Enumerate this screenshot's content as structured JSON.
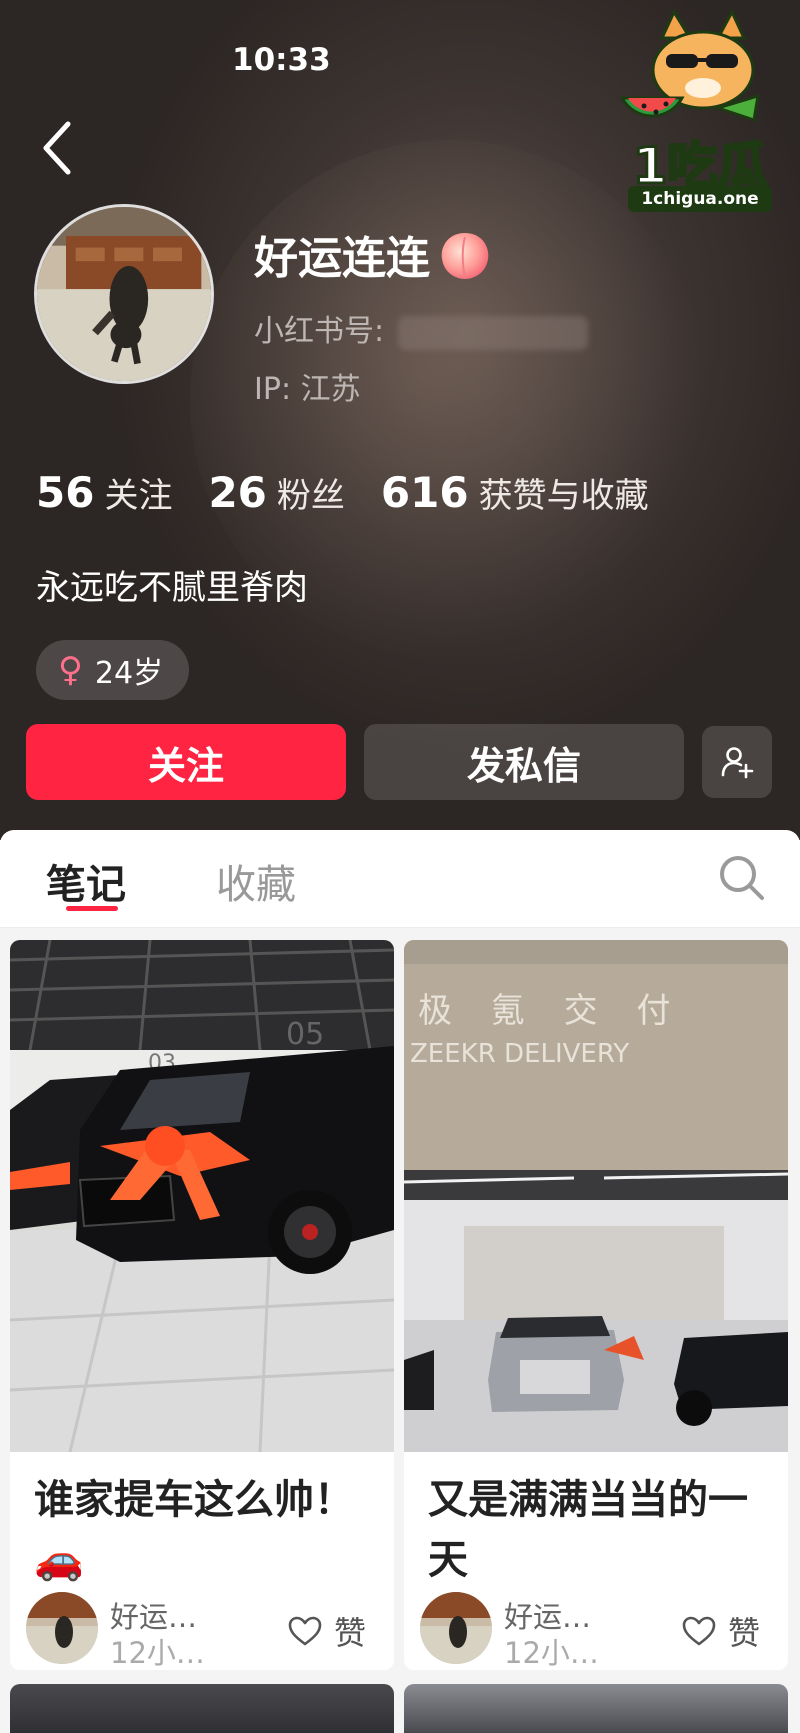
{
  "status_bar": {
    "time": "10:33"
  },
  "profile": {
    "nickname": "好运连连",
    "red_id_label": "小红书号:",
    "ip_location": "IP: 江苏",
    "stats": [
      {
        "value": "56",
        "label": "关注"
      },
      {
        "value": "26",
        "label": "粉丝"
      },
      {
        "value": "616",
        "label": "获赞与收藏"
      }
    ],
    "bio": "永远吃不腻里脊肉",
    "gender_symbol": "♀",
    "age_tag": "24岁"
  },
  "actions": {
    "follow_label": "关注",
    "message_label": "发私信"
  },
  "tabs": [
    {
      "label": "笔记",
      "active": true
    },
    {
      "label": "收藏",
      "active": false
    }
  ],
  "notes": [
    {
      "title": "谁家提车这么帅！🚗",
      "author": "好运…",
      "time": "12小…",
      "like_label": "赞"
    },
    {
      "title": "又是满满当当的一天",
      "author": "好运…",
      "time": "12小…",
      "like_label": "赞"
    }
  ],
  "watermark": {
    "brand": "1吃瓜",
    "site": "1chigua.one"
  },
  "colors": {
    "accent": "#ff2442",
    "header_bg": "#3a3230"
  }
}
